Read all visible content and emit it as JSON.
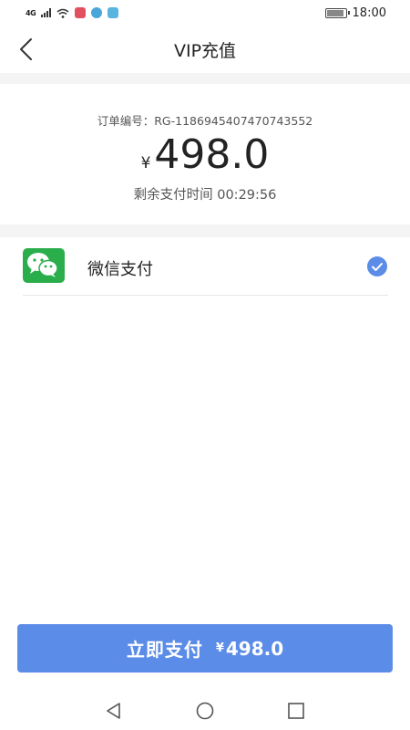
{
  "status_bar": {
    "network": "4G",
    "time": "18:00"
  },
  "nav": {
    "title": "VIP充值",
    "back_icon": "chevron-left-icon"
  },
  "order": {
    "order_number_text": "订单编号：RG-1186945407470743552",
    "currency_symbol": "¥",
    "amount": "498.0",
    "countdown_text": "剩余支付时间 00:29:56"
  },
  "payment_method": {
    "label": "微信支付",
    "icon": "wechat-icon",
    "selected": true,
    "brand_color": "#2aae4b",
    "check_color": "#5b8ce8"
  },
  "pay_button": {
    "label": "立即支付",
    "currency_symbol": "¥",
    "amount": "498.0",
    "color": "#5b8ce8"
  },
  "system_nav": {
    "back": "triangle-back-icon",
    "home": "circle-home-icon",
    "recent": "square-recent-icon"
  }
}
